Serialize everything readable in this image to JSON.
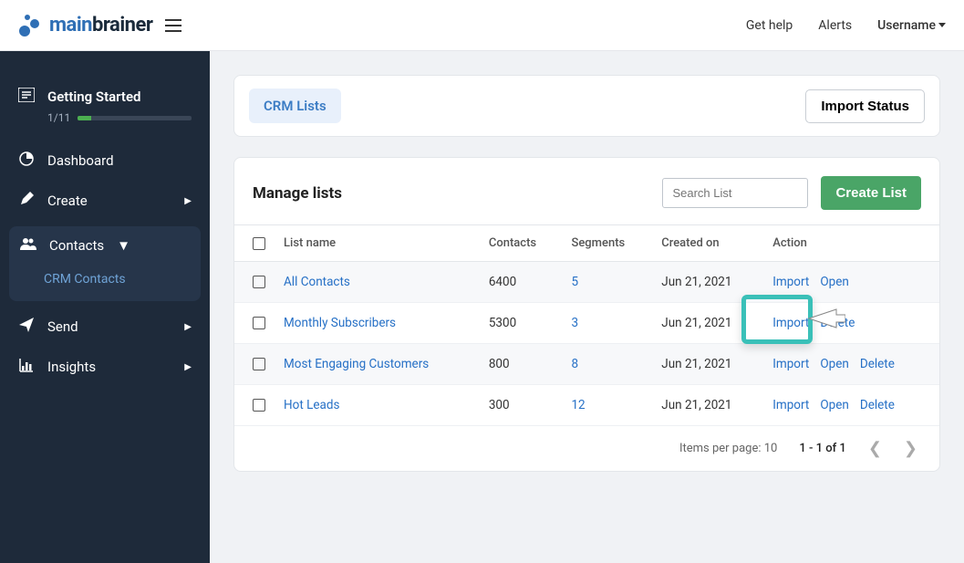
{
  "topbar": {
    "getHelp": "Get help",
    "alerts": "Alerts",
    "username": "Username"
  },
  "logo": {
    "main": "main",
    "brainer": "brainer"
  },
  "sidebar": {
    "gettingStarted": {
      "label": "Getting Started",
      "progress": "1/11"
    },
    "dashboard": "Dashboard",
    "create": "Create",
    "contacts": "Contacts",
    "crmContacts": "CRM Contacts",
    "send": "Send",
    "insights": "Insights"
  },
  "header": {
    "crmLists": "CRM Lists",
    "importStatus": "Import Status"
  },
  "manage": {
    "title": "Manage lists",
    "searchPlaceholder": "Search List",
    "createList": "Create List"
  },
  "columns": {
    "listName": "List name",
    "contacts": "Contacts",
    "segments": "Segments",
    "createdOn": "Created on",
    "action": "Action"
  },
  "actions": {
    "import": "Import",
    "open": "Open",
    "delete": "Delete"
  },
  "rows": [
    {
      "name": "All Contacts",
      "contacts": "6400",
      "segments": "5",
      "created": "Jun 21, 2021",
      "hasOpen": true,
      "hasDelete": false
    },
    {
      "name": "Monthly Subscribers",
      "contacts": "5300",
      "segments": "3",
      "created": "Jun 21, 2021",
      "hasOpen": false,
      "hasDelete": true
    },
    {
      "name": "Most Engaging Customers",
      "contacts": "800",
      "segments": "8",
      "created": "Jun 21, 2021",
      "hasOpen": true,
      "hasDelete": true
    },
    {
      "name": "Hot Leads",
      "contacts": "300",
      "segments": "12",
      "created": "Jun 21, 2021",
      "hasOpen": true,
      "hasDelete": true
    }
  ],
  "pagination": {
    "itemsPerPage": "Items per page: 10",
    "range": "1 - 1 of 1"
  }
}
